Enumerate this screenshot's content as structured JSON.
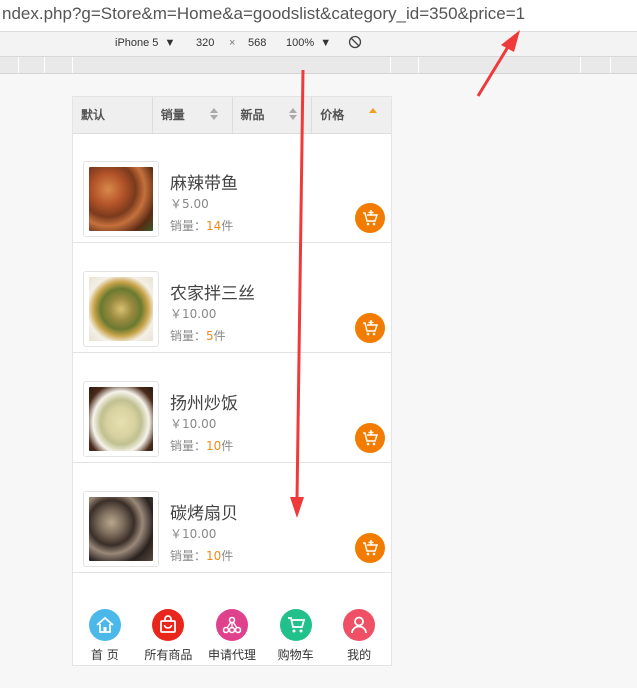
{
  "browser": {
    "url": "ndex.php?g=Store&m=Home&a=goodslist&category_id=350&price=1"
  },
  "device_toolbar": {
    "device": "iPhone 5",
    "width": "320",
    "times": "×",
    "height": "568",
    "zoom": "100%"
  },
  "sort_tabs": [
    {
      "label": "默认"
    },
    {
      "label": "销量"
    },
    {
      "label": "新品"
    },
    {
      "label": "价格"
    }
  ],
  "products": [
    {
      "name": "麻辣带鱼",
      "price": "￥5.00",
      "sales_label": "销量：",
      "sales": "14",
      "unit": "件"
    },
    {
      "name": "农家拌三丝",
      "price": "￥10.00",
      "sales_label": "销量：",
      "sales": "5",
      "unit": "件"
    },
    {
      "name": "扬州炒饭",
      "price": "￥10.00",
      "sales_label": "销量：",
      "sales": "10",
      "unit": "件"
    },
    {
      "name": "碳烤扇贝",
      "price": "￥10.00",
      "sales_label": "销量：",
      "sales": "10",
      "unit": "件"
    }
  ],
  "bottom_nav": [
    {
      "label": "首 页",
      "icon": "home-icon",
      "color": "#4ab8e8"
    },
    {
      "label": "所有商品",
      "icon": "shopping-bag-icon",
      "color": "#e8261c"
    },
    {
      "label": "申请代理",
      "icon": "network-icon",
      "color": "#e0418c"
    },
    {
      "label": "购物车",
      "icon": "cart-icon",
      "color": "#22c08a"
    },
    {
      "label": "我的",
      "icon": "user-icon",
      "color": "#ef5066"
    }
  ],
  "colors": {
    "accent": "#f27c00",
    "annotation": "#f03a3a"
  }
}
